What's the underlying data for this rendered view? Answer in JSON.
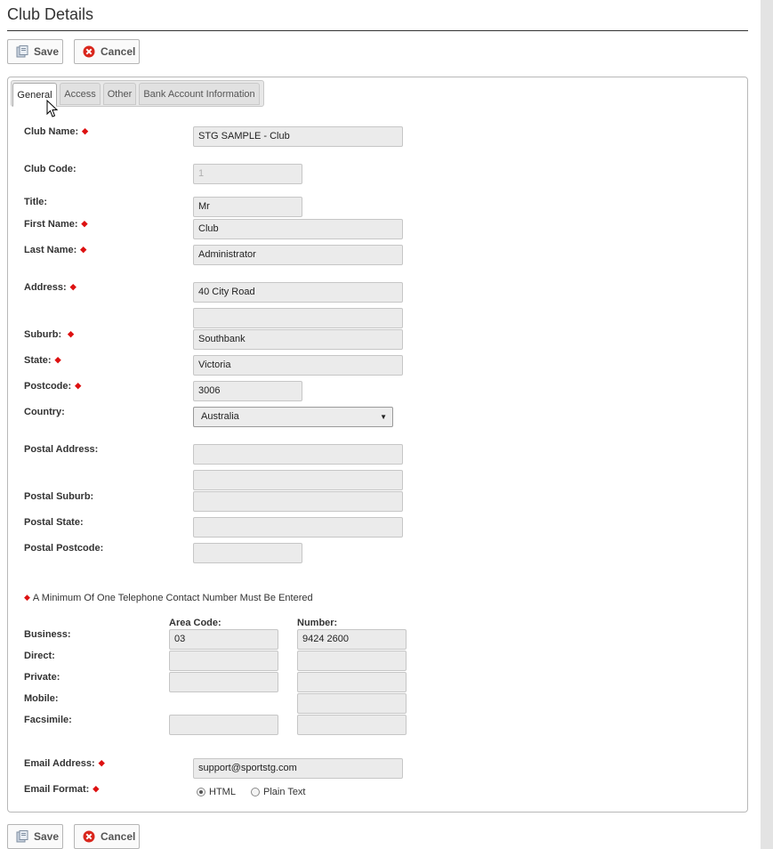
{
  "page": {
    "title": "Club Details"
  },
  "toolbar": {
    "save_label": "Save",
    "cancel_label": "Cancel"
  },
  "tabs": [
    {
      "label": "General",
      "active": true
    },
    {
      "label": "Access",
      "active": false
    },
    {
      "label": "Other",
      "active": false
    },
    {
      "label": "Bank Account Information",
      "active": false
    }
  ],
  "form": {
    "club_name": {
      "label": "Club Name:",
      "value": "STG SAMPLE - Club",
      "required": true
    },
    "club_code": {
      "label": "Club Code:",
      "value": "1",
      "required": false
    },
    "title": {
      "label": "Title:",
      "value": "Mr"
    },
    "first_name": {
      "label": "First Name:",
      "value": "Club",
      "required": true
    },
    "last_name": {
      "label": "Last Name:",
      "value": "Administrator",
      "required": true
    },
    "address": {
      "label": "Address:",
      "line1": "40 City Road",
      "line2": "",
      "required": true
    },
    "suburb": {
      "label": "Suburb:",
      "value": "Southbank",
      "required": true
    },
    "state": {
      "label": "State:",
      "value": "Victoria",
      "required": true
    },
    "postcode": {
      "label": "Postcode:",
      "value": "3006",
      "required": true
    },
    "country": {
      "label": "Country:",
      "value": "Australia"
    },
    "postal_address": {
      "label": "Postal Address:",
      "line1": "",
      "line2": ""
    },
    "postal_suburb": {
      "label": "Postal Suburb:",
      "value": ""
    },
    "postal_state": {
      "label": "Postal State:",
      "value": ""
    },
    "postal_postcode": {
      "label": "Postal Postcode:",
      "value": ""
    }
  },
  "phone": {
    "note": "A Minimum Of One Telephone Contact Number Must Be Entered",
    "area_code_header": "Area Code:",
    "number_header": "Number:",
    "rows": [
      {
        "label": "Business:",
        "area": "03",
        "number": "9424 2600"
      },
      {
        "label": "Direct:",
        "area": "",
        "number": ""
      },
      {
        "label": "Private:",
        "area": "",
        "number": ""
      },
      {
        "label": "Mobile:",
        "number": ""
      },
      {
        "label": "Facsimile:",
        "area": "",
        "number": ""
      }
    ]
  },
  "email": {
    "label": "Email Address:",
    "value": "support@sportstg.com",
    "format_label": "Email Format:",
    "options": [
      "HTML",
      "Plain Text"
    ],
    "selected": "HTML"
  },
  "colors": {
    "required": "#dd1111",
    "field_bg": "#ebebeb",
    "cancel_icon": "#d9261c"
  }
}
